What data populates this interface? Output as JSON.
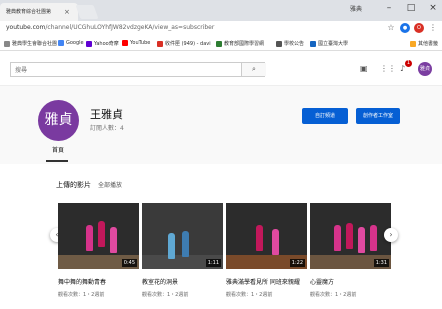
{
  "browser": {
    "tab_title": "雅典教育綜合社團第",
    "tab_close": "×",
    "window_user": "雅典",
    "minimize": "–",
    "restore": "□",
    "close": "×",
    "url_host": "youtube.com",
    "url_path": "/channel/UCGhuLOYhfJW82vdzgeKA/view_as=subscriber",
    "bookmarks": [
      {
        "label": "雅典學生會聯合社團",
        "color": "#888888"
      },
      {
        "label": "Google",
        "color": "#4285f4"
      },
      {
        "label": "Yahoo奇摩",
        "color": "#6001d2"
      },
      {
        "label": "YouTube",
        "color": "#ff0000"
      },
      {
        "label": "收件匣 (949) - davi",
        "color": "#d93025"
      },
      {
        "label": "教育部國際學習網",
        "color": "#2e7d32"
      },
      {
        "label": "學校公告",
        "color": "#555555"
      },
      {
        "label": "國立臺灣大學",
        "color": "#1565c0"
      },
      {
        "label": "其他書籤",
        "color": "#f9a825"
      }
    ]
  },
  "topbar": {
    "search_placeholder": "搜尋",
    "notification_count": "1",
    "avatar_text": "雅貞"
  },
  "channel": {
    "avatar_text": "雅貞",
    "name": "王雅貞",
    "subscribers": "訂閱人數：4",
    "customize_label": "自訂頻道",
    "studio_label": "創作者工作室",
    "home_tab": "首頁"
  },
  "uploads": {
    "title": "上傳的影片",
    "play_all": "全部播放",
    "videos": [
      {
        "title": "舞中舞的舞動青春",
        "duration": "0:45",
        "meta": "觀看次數：1・2週前"
      },
      {
        "title": "教室花的洞景",
        "duration": "1:11",
        "meta": "觀看次數：1・2週前"
      },
      {
        "title": "雅典滿學看見所 同班來親耀",
        "duration": "1:22",
        "meta": "觀看次數：1・2週前"
      },
      {
        "title": "心靈魔方",
        "duration": "1:31",
        "meta": "觀看次數：1・2週前"
      }
    ]
  },
  "colors": {
    "accent_blue": "#065fd4",
    "avatar_purple": "#7a3aa0",
    "youtube_red": "#cc0000"
  },
  "icons": {
    "back_arrow": "chevron-left-icon",
    "forward_arrow": "chevron-right-icon"
  }
}
